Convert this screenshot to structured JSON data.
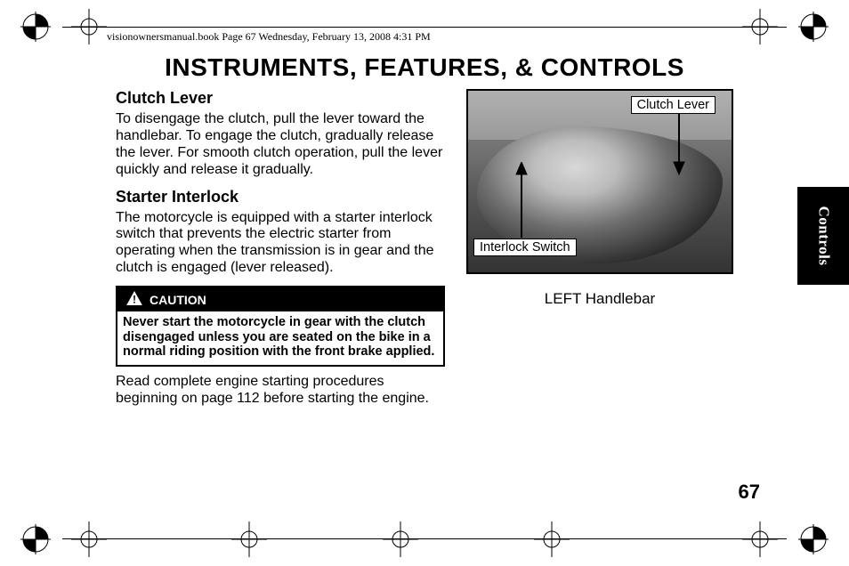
{
  "header": {
    "book_info": "visionownersmanual.book  Page 67  Wednesday, February 13, 2008  4:31 PM"
  },
  "page": {
    "title": "INSTRUMENTS, FEATURES, & CONTROLS",
    "number": "67"
  },
  "side_tab": {
    "label": "Controls"
  },
  "sections": {
    "clutch_lever": {
      "heading": "Clutch Lever",
      "body": "To disengage the clutch, pull the lever toward the handlebar. To engage the clutch, gradually release the lever. For smooth clutch operation, pull the lever quickly and release it gradually."
    },
    "starter_interlock": {
      "heading": "Starter Interlock",
      "body": "The motorcycle is equipped with a starter interlock switch that prevents the electric starter from operating when the transmission is in gear and the clutch is engaged (lever released)."
    },
    "caution": {
      "label": "CAUTION",
      "body": "Never start the motorcycle in gear with the clutch disengaged unless you are seated on the bike in a normal riding position with the front brake applied."
    },
    "post_caution": {
      "body": "Read complete engine starting procedures beginning on page 112 before starting the engine."
    }
  },
  "figure": {
    "callout_clutch": "Clutch Lever",
    "callout_interlock": "Interlock Switch",
    "caption": "LEFT Handlebar"
  }
}
